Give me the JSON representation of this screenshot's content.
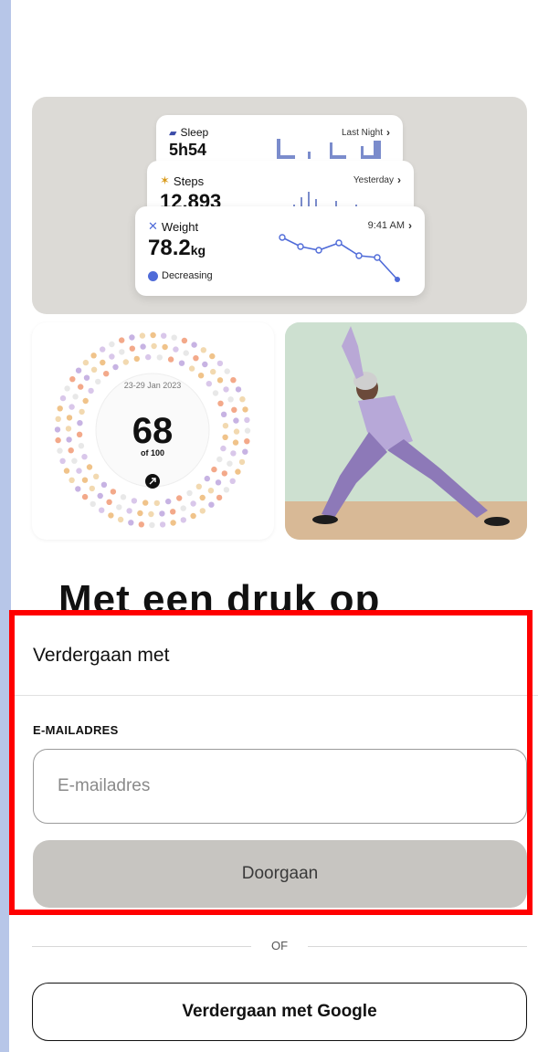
{
  "cards": {
    "sleep": {
      "label": "Sleep",
      "value": "5h54",
      "when": "Last Night",
      "icon": "bed-icon"
    },
    "steps": {
      "label": "Steps",
      "value": "12.893",
      "when": "Yesterday",
      "icon": "walking-icon"
    },
    "weight": {
      "label": "Weight",
      "value": "78.2",
      "unit": "kg",
      "when": "9:41 AM",
      "trend": "Decreasing",
      "icon": "person-icon"
    }
  },
  "score": {
    "date_range": "23-29 Jan 2023",
    "value": "68",
    "of": "of 100",
    "icon": "arrow-up-right-icon"
  },
  "heading_partial": "Met een druk op",
  "sheet": {
    "title": "Verdergaan met",
    "email_label": "E-MAILADRES",
    "email_placeholder": "E-mailadres",
    "email_value": "",
    "continue_label": "Doorgaan",
    "or_label": "OF",
    "google_label": "Verdergaan met Google"
  },
  "colors": {
    "accent_blue": "#4f6bd8",
    "button_disabled": "#c7c5c1",
    "highlight": "#ff0000"
  }
}
